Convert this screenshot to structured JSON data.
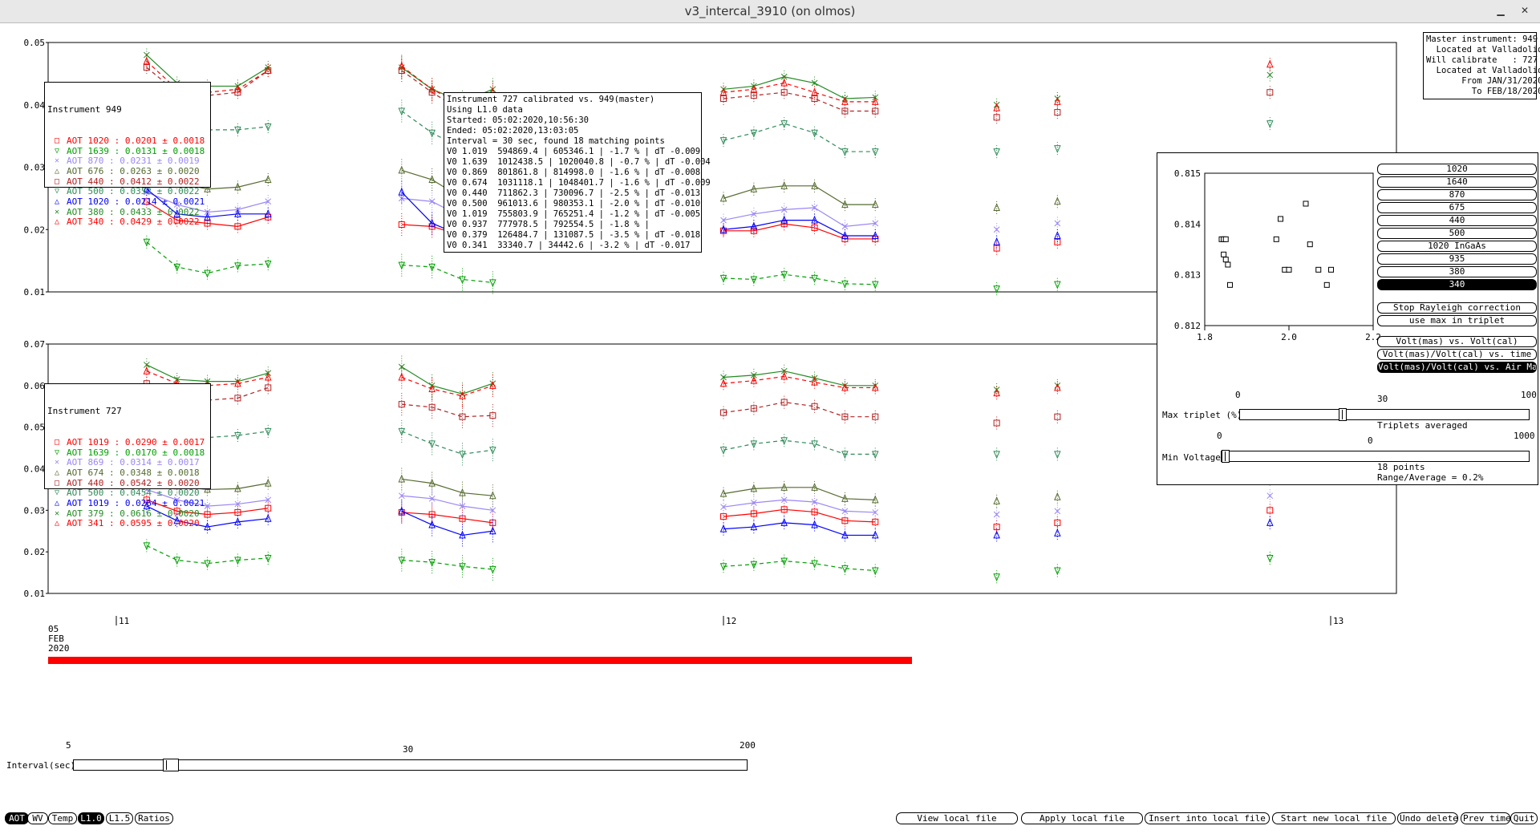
{
  "window": {
    "title": "v3_intercal_3910 (on olmos)",
    "minimize_glyph": "▁",
    "close_glyph": "✕",
    "minimize_icon": "minimize-icon",
    "close_icon": "close-icon"
  },
  "top_plot": {
    "y_ticks": [
      "0.05",
      "0.04",
      "0.03",
      "0.02",
      "0.01"
    ],
    "legend": {
      "title": "Instrument 949",
      "entries": [
        {
          "label": "AOT 1020 :",
          "value": "0.0201 ± 0.0018",
          "color": "#ff0000",
          "marker": "□"
        },
        {
          "label": "AOT 1639 :",
          "value": "0.0131 ± 0.0018",
          "color": "#00a000",
          "marker": "▽"
        },
        {
          "label": "AOT 870 :",
          "value": "0.0231 ± 0.0019",
          "color": "#9b87f5",
          "marker": "✕"
        },
        {
          "label": "AOT 676 :",
          "value": "0.0263 ± 0.0020",
          "color": "#556b2f",
          "marker": "△"
        },
        {
          "label": "AOT 440 :",
          "value": "0.0412 ± 0.0022",
          "color": "#b22222",
          "marker": "□"
        },
        {
          "label": "AOT 500 :",
          "value": "0.0352 ± 0.0022",
          "color": "#2e8b57",
          "marker": "▽"
        },
        {
          "label": "AOT 1020 :",
          "value": "0.0214 ± 0.0021",
          "color": "#0000ff",
          "marker": "△"
        },
        {
          "label": "AOT 380 :",
          "value": "0.0433 ± 0.0022",
          "color": "#228b22",
          "marker": "✕"
        },
        {
          "label": "AOT 340 :",
          "value": "0.0429 ± 0.0022",
          "color": "#ff0000",
          "marker": "△"
        }
      ]
    }
  },
  "bottom_plot": {
    "y_ticks": [
      "0.07",
      "0.06",
      "0.05",
      "0.04",
      "0.03",
      "0.02",
      "0.01"
    ],
    "legend": {
      "title": "Instrument 727",
      "entries": [
        {
          "label": "AOT 1019 :",
          "value": "0.0290 ± 0.0017",
          "color": "#ff0000",
          "marker": "□"
        },
        {
          "label": "AOT 1639 :",
          "value": "0.0170 ± 0.0018",
          "color": "#00a000",
          "marker": "▽"
        },
        {
          "label": "AOT 869 :",
          "value": "0.0314 ± 0.0017",
          "color": "#9b87f5",
          "marker": "✕"
        },
        {
          "label": "AOT 674 :",
          "value": "0.0348 ± 0.0018",
          "color": "#556b2f",
          "marker": "△"
        },
        {
          "label": "AOT 440 :",
          "value": "0.0542 ± 0.0020",
          "color": "#b22222",
          "marker": "□"
        },
        {
          "label": "AOT 500 :",
          "value": "0.0454 ± 0.0020",
          "color": "#2e8b57",
          "marker": "▽"
        },
        {
          "label": "AOT 1019 :",
          "value": "0.0264 ± 0.0021",
          "color": "#0000ff",
          "marker": "△"
        },
        {
          "label": "AOT 379 :",
          "value": "0.0616 ± 0.0020",
          "color": "#228b22",
          "marker": "✕"
        },
        {
          "label": "AOT 341 :",
          "value": "0.0595 ± 0.0020",
          "color": "#ff0000",
          "marker": "△"
        }
      ]
    }
  },
  "x_axis": {
    "ticks": [
      "11",
      "12",
      "13"
    ],
    "date_day": "05",
    "date_month": "FEB",
    "date_year": "2020"
  },
  "info_box": {
    "lines": [
      "Instrument 727 calibrated vs. 949(master)",
      "Using L1.0 data",
      "Started: 05:02:2020,10:56:30",
      "Ended: 05:02:2020,13:03:05",
      "Interval = 30 sec, found 18 matching points",
      "V0 1.019  594869.4 | 605346.1 | -1.7 % | dT -0.009",
      "V0 1.639  1012438.5 | 1020040.8 | -0.7 % | dT -0.004",
      "V0 0.869  801861.8 | 814998.0 | -1.6 % | dT -0.008",
      "V0 0.674  1031118.1 | 1048401.7 | -1.6 % | dT -0.009",
      "V0 0.440  711862.3 | 730096.7 | -2.5 % | dT -0.013",
      "V0 0.500  961013.6 | 980353.1 | -2.0 % | dT -0.010",
      "V0 1.019  755803.9 | 765251.4 | -1.2 % | dT -0.005",
      "V0 0.937  777978.5 | 792554.5 | -1.8 % |",
      "V0 0.379  126484.7 | 131087.5 | -3.5 % | dT -0.018",
      "V0 0.341  33340.7 | 34442.6 | -3.2 % | dT -0.017"
    ]
  },
  "master_box": {
    "lines": [
      "Master instrument: 949",
      "  Located at Valladolid",
      "Will calibrate   : 727",
      "  Located at Valladolid",
      "       From JAN/31/2020",
      "         To FEB/18/2020"
    ]
  },
  "side_panel": {
    "wave_buttons": [
      {
        "label": "1020",
        "active": false
      },
      {
        "label": "1640",
        "active": false
      },
      {
        "label": "870",
        "active": false
      },
      {
        "label": "675",
        "active": false
      },
      {
        "label": "440",
        "active": false
      },
      {
        "label": "500",
        "active": false
      },
      {
        "label": "1020 InGaAs",
        "active": false
      },
      {
        "label": "935",
        "active": false
      },
      {
        "label": "380",
        "active": false
      },
      {
        "label": "340",
        "active": true
      }
    ],
    "mode_buttons": [
      {
        "label": "Stop Rayleigh correction",
        "active": false
      },
      {
        "label": "use max in triplet",
        "active": false
      }
    ],
    "view_buttons": [
      {
        "label": "Volt(mas) vs. Volt(cal)",
        "active": false
      },
      {
        "label": "Volt(mas)/Volt(cal) vs. time",
        "active": false
      },
      {
        "label": "Volt(mas)/Volt(cal) vs. Air Mass",
        "active": true
      }
    ],
    "max_triplet": {
      "label": "Max triplet (%)",
      "min": "0",
      "mid": "30",
      "max": "100",
      "note": "Triplets averaged",
      "value_fraction": 0.35
    },
    "min_voltage": {
      "label": "Min Voltage",
      "min": "0",
      "mid": "0",
      "max": "1000",
      "note1": "18 points",
      "note2": "Range/Average = 0.2%",
      "value_fraction": 0.0
    }
  },
  "interval_slider": {
    "label": "Interval(sec)",
    "min": "5",
    "mid": "30",
    "max": "200",
    "value_fraction": 0.135
  },
  "bottom_left_buttons": [
    {
      "label": "AOT",
      "active": true
    },
    {
      "label": "WV",
      "active": false
    },
    {
      "label": "Temp",
      "active": false
    },
    {
      "label": "L1.0",
      "active": true
    },
    {
      "label": "L1.5",
      "active": false
    },
    {
      "label": "Ratios",
      "active": false
    }
  ],
  "bottom_right_buttons": [
    {
      "label": "View local file"
    },
    {
      "label": "Apply local file"
    },
    {
      "label": "Insert into local file"
    },
    {
      "label": "Start new local file"
    },
    {
      "label": "Undo delete"
    },
    {
      "label": "Prev time"
    },
    {
      "label": "Quit"
    }
  ],
  "chart_data": [
    {
      "type": "line",
      "title": "",
      "x": [
        11.05,
        11.1,
        11.15,
        11.2,
        11.25,
        11.47,
        11.52,
        11.57,
        11.62,
        12.0,
        12.05,
        12.1,
        12.15,
        12.2,
        12.25,
        12.45,
        12.55,
        12.9
      ],
      "x_ticks": [
        "11",
        "12",
        "13"
      ],
      "ylim": [
        0.01,
        0.05
      ],
      "series": [
        {
          "name": "AOT 1020",
          "color": "#ff0000",
          "values": [
            0.0245,
            0.0215,
            0.021,
            0.0205,
            0.022,
            0.0208,
            0.0205,
            0.019,
            0.0185,
            0.0198,
            0.0198,
            0.0209,
            0.0203,
            0.0185,
            0.0185,
            0.017,
            0.018,
            0.026
          ]
        },
        {
          "name": "AOT 1639",
          "color": "#00a000",
          "values": [
            0.018,
            0.014,
            0.013,
            0.0142,
            0.0145,
            0.0143,
            0.014,
            0.012,
            0.0115,
            0.0122,
            0.012,
            0.0128,
            0.0122,
            0.0113,
            0.0112,
            0.0105,
            0.0112,
            0.0145
          ]
        },
        {
          "name": "AOT 870",
          "color": "#9b87f5",
          "values": [
            0.026,
            0.024,
            0.0228,
            0.0232,
            0.0245,
            0.025,
            0.0245,
            0.022,
            0.022,
            0.0215,
            0.0225,
            0.0232,
            0.0235,
            0.0205,
            0.021,
            0.02,
            0.021,
            0.028
          ]
        },
        {
          "name": "AOT 676",
          "color": "#556b2f",
          "values": [
            0.03,
            0.0275,
            0.0265,
            0.0268,
            0.028,
            0.0295,
            0.028,
            0.025,
            0.0245,
            0.025,
            0.0265,
            0.027,
            0.027,
            0.024,
            0.024,
            0.0235,
            0.0245,
            0.031
          ]
        },
        {
          "name": "AOT 440",
          "color": "#b22222",
          "values": [
            0.046,
            0.042,
            0.0415,
            0.042,
            0.0455,
            0.0455,
            0.042,
            0.039,
            0.041,
            0.041,
            0.0415,
            0.042,
            0.041,
            0.039,
            0.039,
            0.038,
            0.0388,
            0.042
          ]
        },
        {
          "name": "AOT 500",
          "color": "#2e8b57",
          "values": [
            0.039,
            0.037,
            0.036,
            0.036,
            0.0365,
            0.039,
            0.0355,
            0.033,
            0.034,
            0.0343,
            0.0355,
            0.037,
            0.0355,
            0.0325,
            0.0325,
            0.0325,
            0.033,
            0.037
          ]
        },
        {
          "name": "AOT 1020",
          "color": "#0000ff",
          "values": [
            0.0265,
            0.0225,
            0.022,
            0.0225,
            0.0225,
            0.026,
            0.021,
            0.019,
            0.02,
            0.02,
            0.0205,
            0.0215,
            0.0215,
            0.019,
            0.019,
            0.018,
            0.019,
            0.025
          ]
        },
        {
          "name": "AOT 380",
          "color": "#228b22",
          "values": [
            0.048,
            0.0435,
            0.043,
            0.043,
            0.046,
            0.046,
            0.0425,
            0.0405,
            0.0425,
            0.0425,
            0.043,
            0.0445,
            0.0435,
            0.041,
            0.0412,
            0.04,
            0.041,
            0.0448
          ]
        },
        {
          "name": "AOT 340",
          "color": "#ff0000",
          "values": [
            0.047,
            0.0425,
            0.042,
            0.0425,
            0.0455,
            0.0462,
            0.0425,
            0.04,
            0.042,
            0.042,
            0.0425,
            0.0435,
            0.042,
            0.0405,
            0.0405,
            0.0395,
            0.0405,
            0.0465
          ]
        }
      ]
    },
    {
      "type": "line",
      "title": "",
      "x": [
        11.05,
        11.1,
        11.15,
        11.2,
        11.25,
        11.47,
        11.52,
        11.57,
        11.62,
        12.0,
        12.05,
        12.1,
        12.15,
        12.2,
        12.25,
        12.45,
        12.55,
        12.9
      ],
      "x_ticks": [
        "11",
        "12",
        "13"
      ],
      "ylim": [
        0.01,
        0.07
      ],
      "series": [
        {
          "name": "AOT 1019",
          "color": "#ff0000",
          "values": [
            0.0325,
            0.0298,
            0.029,
            0.0295,
            0.0305,
            0.0295,
            0.029,
            0.028,
            0.027,
            0.0285,
            0.0292,
            0.0302,
            0.0296,
            0.0275,
            0.0272,
            0.026,
            0.027,
            0.03
          ]
        },
        {
          "name": "AOT 1639",
          "color": "#00a000",
          "values": [
            0.0215,
            0.018,
            0.0172,
            0.018,
            0.0185,
            0.018,
            0.0175,
            0.0165,
            0.0158,
            0.0165,
            0.017,
            0.0178,
            0.0172,
            0.016,
            0.0155,
            0.014,
            0.0155,
            0.0185
          ]
        },
        {
          "name": "AOT 869",
          "color": "#9b87f5",
          "values": [
            0.035,
            0.0325,
            0.031,
            0.0315,
            0.0325,
            0.0335,
            0.0328,
            0.031,
            0.03,
            0.0308,
            0.0318,
            0.0325,
            0.032,
            0.0298,
            0.0295,
            0.029,
            0.0298,
            0.0335
          ]
        },
        {
          "name": "AOT 674",
          "color": "#556b2f",
          "values": [
            0.038,
            0.0358,
            0.035,
            0.0352,
            0.0365,
            0.0375,
            0.0365,
            0.0342,
            0.0335,
            0.034,
            0.0352,
            0.0355,
            0.0355,
            0.0328,
            0.0325,
            0.0322,
            0.0332,
            0.0375
          ]
        },
        {
          "name": "AOT 440",
          "color": "#b22222",
          "values": [
            0.0605,
            0.0568,
            0.0565,
            0.057,
            0.0595,
            0.0555,
            0.0548,
            0.0525,
            0.0528,
            0.0535,
            0.0545,
            0.056,
            0.055,
            0.0525,
            0.0525,
            0.051,
            0.0525,
            0.0575
          ]
        },
        {
          "name": "AOT 500",
          "color": "#2e8b57",
          "values": [
            0.0505,
            0.0478,
            0.0475,
            0.048,
            0.049,
            0.049,
            0.046,
            0.0435,
            0.0445,
            0.0445,
            0.046,
            0.0468,
            0.046,
            0.0435,
            0.0435,
            0.0435,
            0.0435,
            0.048
          ]
        },
        {
          "name": "AOT 1019",
          "color": "#0000ff",
          "values": [
            0.031,
            0.0275,
            0.026,
            0.0272,
            0.028,
            0.0298,
            0.0265,
            0.024,
            0.025,
            0.0255,
            0.026,
            0.027,
            0.0265,
            0.024,
            0.024,
            0.024,
            0.0245,
            0.027
          ]
        },
        {
          "name": "AOT 379",
          "color": "#228b22",
          "values": [
            0.065,
            0.0615,
            0.061,
            0.061,
            0.063,
            0.0645,
            0.06,
            0.058,
            0.0605,
            0.062,
            0.0625,
            0.0635,
            0.0618,
            0.06,
            0.06,
            0.059,
            0.06,
            0.064
          ]
        },
        {
          "name": "AOT 341",
          "color": "#ff0000",
          "values": [
            0.0635,
            0.0605,
            0.06,
            0.0605,
            0.062,
            0.062,
            0.0592,
            0.0575,
            0.06,
            0.0605,
            0.0612,
            0.0622,
            0.0608,
            0.0595,
            0.0595,
            0.0582,
            0.0595,
            0.0625
          ]
        }
      ]
    },
    {
      "type": "scatter",
      "title": "",
      "xlim": [
        1.8,
        2.2
      ],
      "ylim": [
        0.812,
        0.815
      ],
      "x_ticks": [
        "1.8",
        "2.0",
        "2.2"
      ],
      "y_ticks": [
        "0.815",
        "0.814",
        "0.813",
        "0.812"
      ],
      "points": [
        [
          1.84,
          0.8137
        ],
        [
          1.845,
          0.8137
        ],
        [
          1.85,
          0.8137
        ],
        [
          1.845,
          0.8134
        ],
        [
          1.85,
          0.8133
        ],
        [
          1.855,
          0.8132
        ],
        [
          1.86,
          0.8128
        ],
        [
          1.97,
          0.8137
        ],
        [
          1.98,
          0.8141
        ],
        [
          1.99,
          0.8131
        ],
        [
          2.0,
          0.8131
        ],
        [
          2.04,
          0.8144
        ],
        [
          2.05,
          0.8136
        ],
        [
          2.07,
          0.8131
        ],
        [
          2.09,
          0.8128
        ],
        [
          2.1,
          0.8131
        ]
      ]
    }
  ]
}
